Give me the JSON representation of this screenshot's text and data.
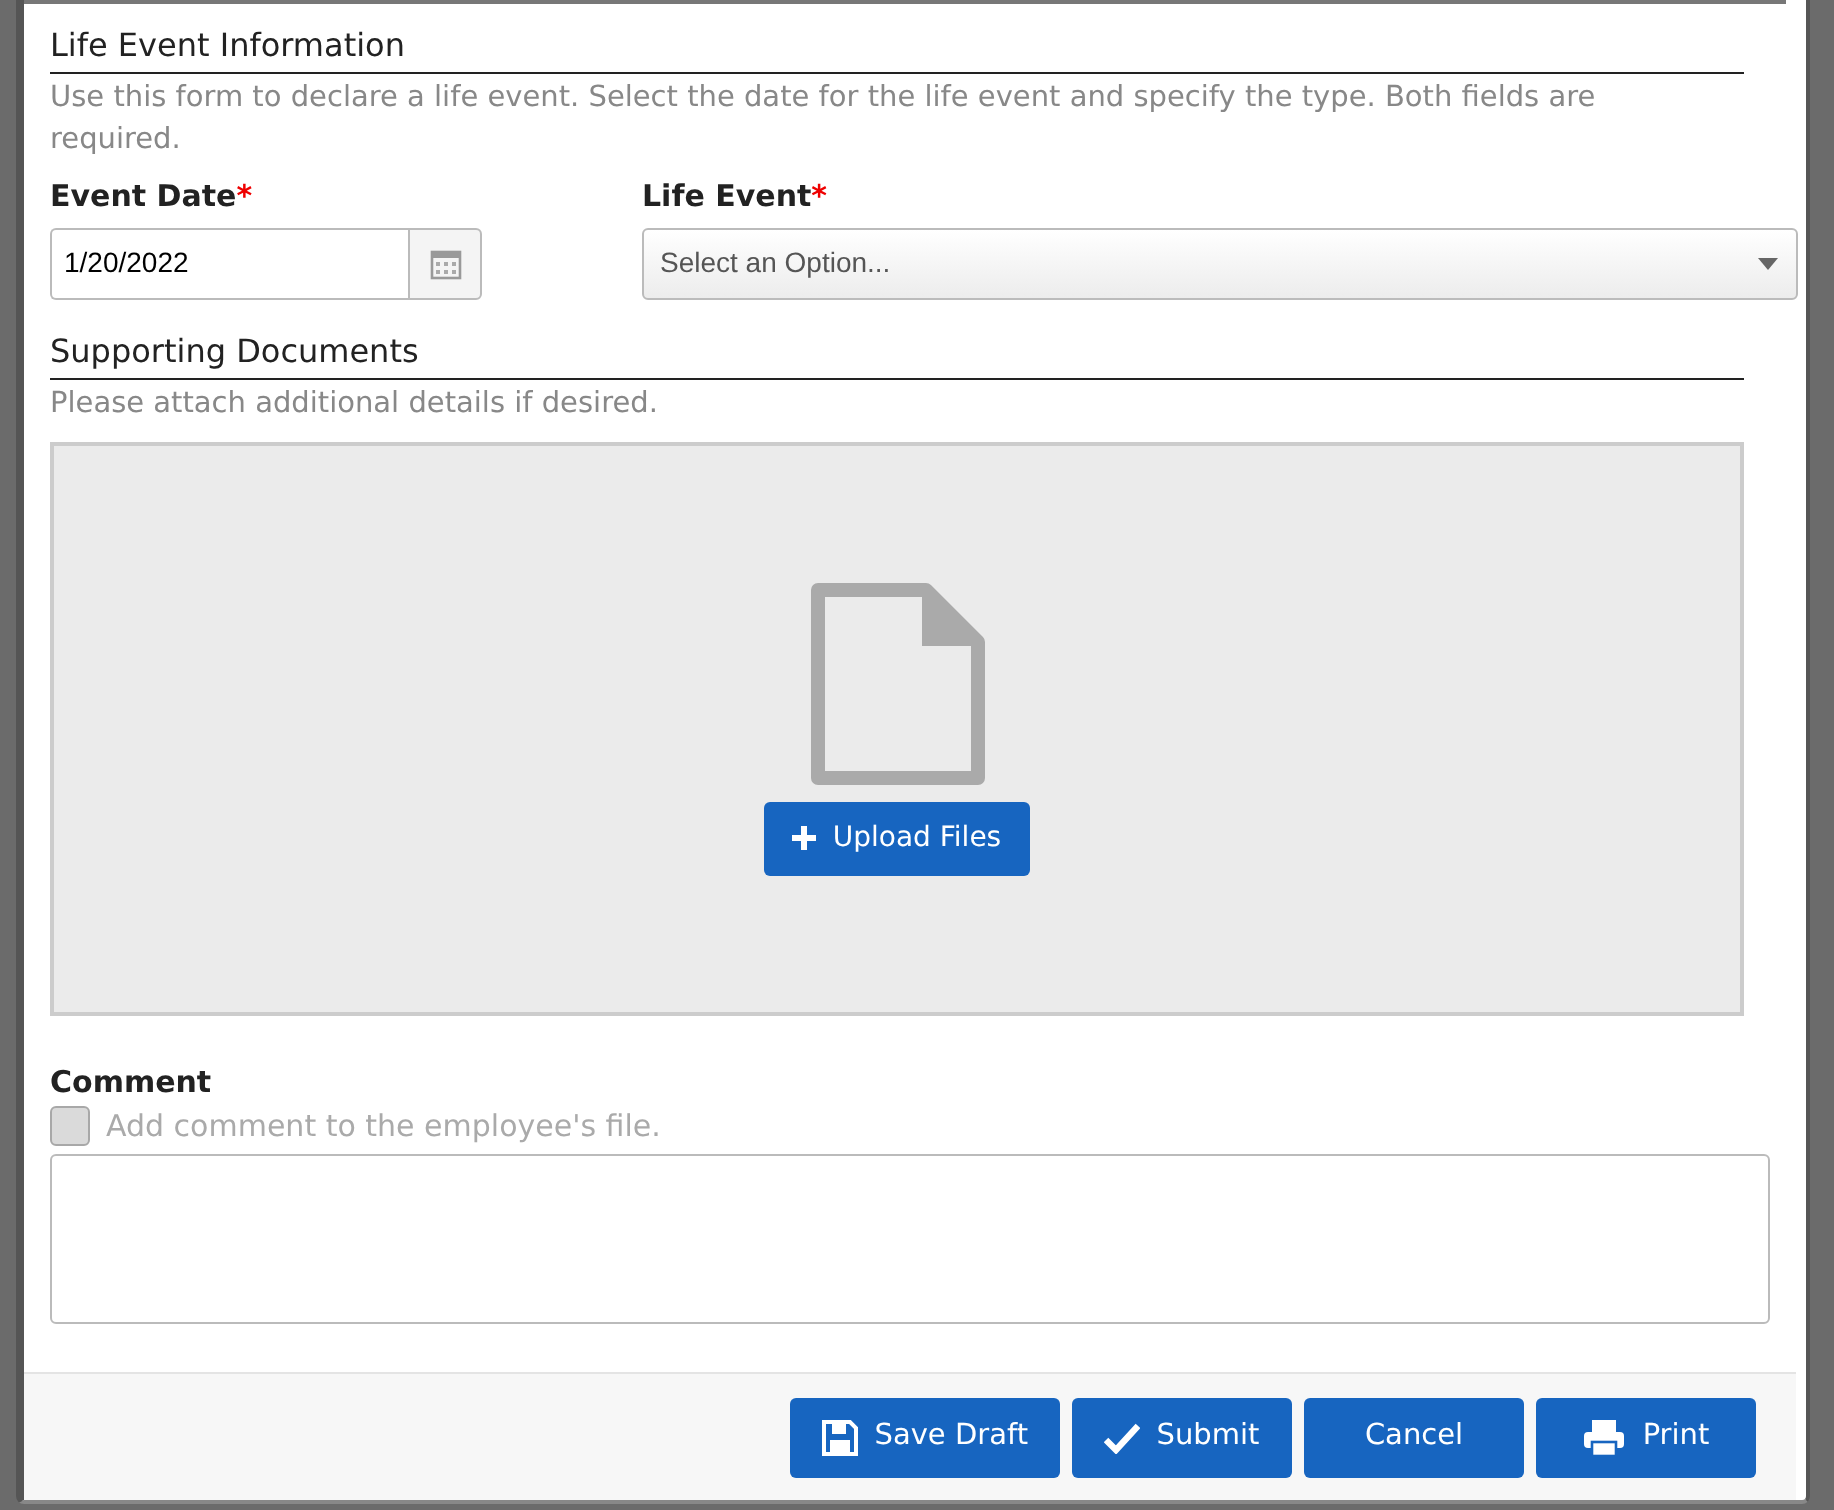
{
  "sections": [
    {
      "kind": "info",
      "title": "Life Event Information",
      "description": "Use this form to declare a life event. Select the date for the life event and specify the type. Both fields are required."
    },
    {
      "kind": "upload",
      "title": "Supporting Documents",
      "description": "Please attach additional details if desired.",
      "upload_button": "Upload Files"
    }
  ],
  "fields": [
    {
      "kind": "date",
      "label": "Event Date",
      "required_mark": "*",
      "value": "1/20/2022"
    },
    {
      "kind": "select",
      "label": "Life Event",
      "required_mark": "*",
      "placeholder": "Select an Option..."
    }
  ],
  "comment": {
    "label": "Comment",
    "checkbox_label": "Add comment to the employee's file.",
    "checked": false,
    "disabled": true
  },
  "buttons": [
    {
      "label": "Save Draft",
      "kind": "save"
    },
    {
      "label": "Submit",
      "kind": "submit"
    },
    {
      "label": "Cancel",
      "kind": "cancel"
    },
    {
      "label": "Print",
      "kind": "print"
    }
  ]
}
